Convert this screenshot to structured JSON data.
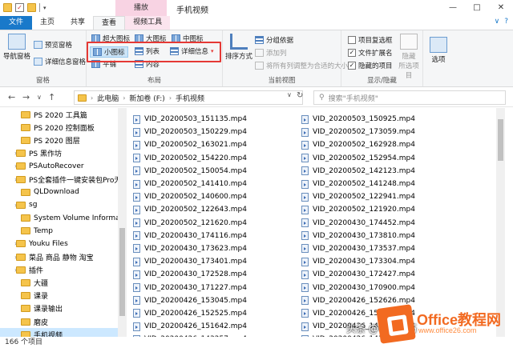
{
  "titlebar": {
    "title": "手机视频",
    "context_tab": "播放",
    "min": "—",
    "max": "□",
    "close": "✕"
  },
  "tabs": {
    "file": "文件",
    "home": "主页",
    "share": "共享",
    "view": "查看",
    "video_tools": "视频工具"
  },
  "ribbon": {
    "pane_group": {
      "label": "窗格",
      "nav_pane": "导航窗格",
      "preview_pane": "预览窗格",
      "details_pane": "详细信息窗格"
    },
    "layout_group": {
      "label": "布局",
      "extra_large": "超大图标",
      "large": "大图标",
      "medium": "中图标",
      "small": "小图标",
      "list": "列表",
      "details": "详细信息",
      "tiles": "平铺",
      "content": "内容"
    },
    "view_group": {
      "label": "当前视图",
      "sort": "排序方式",
      "group_by": "分组依据",
      "add_columns": "添加列",
      "size_all": "将所有列调整为合适的大小"
    },
    "showhide_group": {
      "label": "显示/隐藏",
      "item_checkboxes": "项目复选框",
      "file_extensions": "文件扩展名",
      "hidden_items": "隐藏的项目",
      "hide_selected": "隐藏",
      "hide_selected_2": "所选项目"
    },
    "options": "选项"
  },
  "address": {
    "crumbs": [
      "此电脑",
      "新加卷 (F:)",
      "手机视频"
    ],
    "search_placeholder": "搜索\"手机视频\""
  },
  "nav": [
    {
      "label": "PS 2020 工具篇",
      "arrow": false,
      "selected": false
    },
    {
      "label": "PS 2020 控制面板",
      "arrow": false,
      "selected": false
    },
    {
      "label": "PS 2020 图层",
      "arrow": false,
      "selected": false
    },
    {
      "label": "PS 黑作坊",
      "arrow": true,
      "selected": false
    },
    {
      "label": "PSAutoRecover",
      "arrow": true,
      "selected": false
    },
    {
      "label": "PS全套插件一键安装包Pro无...",
      "arrow": true,
      "selected": false
    },
    {
      "label": "QLDownload",
      "arrow": false,
      "selected": false
    },
    {
      "label": "sg",
      "arrow": true,
      "selected": false
    },
    {
      "label": "System Volume Information",
      "arrow": false,
      "selected": false
    },
    {
      "label": "Temp",
      "arrow": false,
      "selected": false
    },
    {
      "label": "Youku Files",
      "arrow": true,
      "selected": false
    },
    {
      "label": "菜品 商品 静物 淘宝",
      "arrow": true,
      "selected": false
    },
    {
      "label": "插件",
      "arrow": true,
      "selected": false
    },
    {
      "label": "大疆",
      "arrow": false,
      "selected": false
    },
    {
      "label": "课录",
      "arrow": false,
      "selected": false
    },
    {
      "label": "课录输出",
      "arrow": false,
      "selected": false
    },
    {
      "label": "磨皮",
      "arrow": false,
      "selected": false
    },
    {
      "label": "手机视频",
      "arrow": false,
      "selected": true
    }
  ],
  "files_col1": [
    "VID_20200503_151135.mp4",
    "VID_20200503_150229.mp4",
    "VID_20200502_163021.mp4",
    "VID_20200502_154220.mp4",
    "VID_20200502_150054.mp4",
    "VID_20200502_141410.mp4",
    "VID_20200502_140600.mp4",
    "VID_20200502_122643.mp4",
    "VID_20200502_121620.mp4",
    "VID_20200430_174116.mp4",
    "VID_20200430_173623.mp4",
    "VID_20200430_173401.mp4",
    "VID_20200430_172528.mp4",
    "VID_20200430_171227.mp4",
    "VID_20200426_153045.mp4",
    "VID_20200426_152525.mp4",
    "VID_20200426_151642.mp4",
    "VID_20200426_143257.mp4"
  ],
  "files_col2": [
    "VID_20200503_150925.mp4",
    "VID_20200502_173059.mp4",
    "VID_20200502_162928.mp4",
    "VID_20200502_152954.mp4",
    "VID_20200502_142123.mp4",
    "VID_20200502_141248.mp4",
    "VID_20200502_122941.mp4",
    "VID_20200502_121920.mp4",
    "VID_20200430_174452.mp4",
    "VID_20200430_173810.mp4",
    "VID_20200430_173537.mp4",
    "VID_20200430_173304.mp4",
    "VID_20200430_172427.mp4",
    "VID_20200430_170900.mp4",
    "VID_20200426_152626.mp4",
    "VID_20200426_152222.mp4",
    "VID_20200426_145553.mp4",
    "VID_20200426_143810.mp4"
  ],
  "status": {
    "count": "166 个项目"
  },
  "watermark": {
    "attribution": "头条 @电脑技巧",
    "brand": "Office教程网",
    "url": "www.office26.com"
  }
}
